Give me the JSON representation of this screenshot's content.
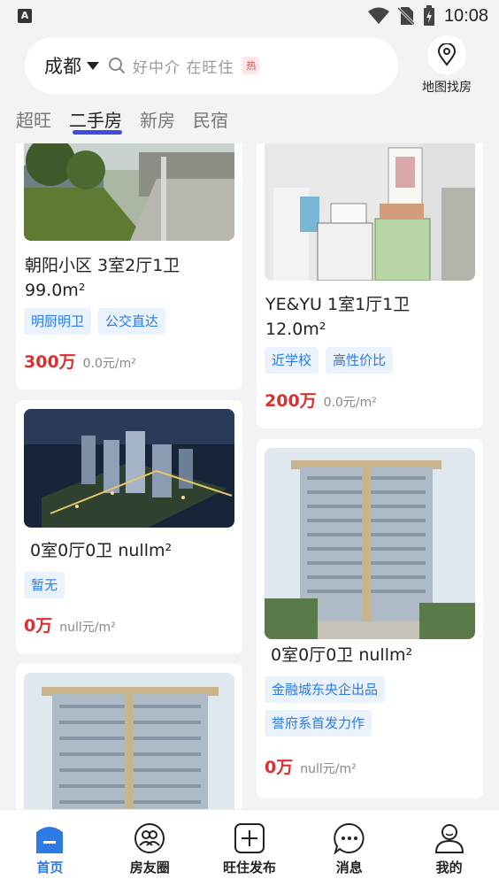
{
  "status": {
    "time": "10:08"
  },
  "search": {
    "city": "成都",
    "placeholder": "好中介 在旺住",
    "hot_badge": "热"
  },
  "map_button": {
    "label": "地图找房"
  },
  "tabs": [
    {
      "label": "超旺"
    },
    {
      "label": "二手房"
    },
    {
      "label": "新房"
    },
    {
      "label": "民宿"
    }
  ],
  "listings": [
    {
      "title_line1": "朝阳小区 3室2厅1卫",
      "title_line2": "99.0m²",
      "tags": [
        "明厨明卫",
        "公交直达"
      ],
      "price": "300万",
      "unit_price": "0.0元/m²"
    },
    {
      "title_line1": "YE&YU 1室1厅1卫",
      "title_line2": "12.0m²",
      "tags": [
        "近学校",
        "高性价比"
      ],
      "price": "200万",
      "unit_price": "0.0元/m²"
    },
    {
      "title_line1": " 0室0厅0卫 nullm²",
      "tags": [
        "暂无"
      ],
      "price": "0万",
      "unit_price": "null元/m²"
    },
    {
      "title_line1": " 0室0厅0卫 nullm²",
      "tags": [
        "金融城东央企出品",
        "誉府系首发力作"
      ],
      "price": "0万",
      "unit_price": "null元/m²"
    },
    {
      "title_line1": ""
    }
  ],
  "nav": [
    {
      "label": "首页",
      "icon": "home-icon",
      "active": true
    },
    {
      "label": "房友圈",
      "icon": "people-icon"
    },
    {
      "label": "旺住发布",
      "icon": "plus-icon"
    },
    {
      "label": "消息",
      "icon": "message-icon"
    },
    {
      "label": "我的",
      "icon": "user-icon"
    }
  ],
  "colors": {
    "accent": "#2c7be5",
    "price": "#d93030",
    "tab_underline": "#3b4ee0"
  }
}
